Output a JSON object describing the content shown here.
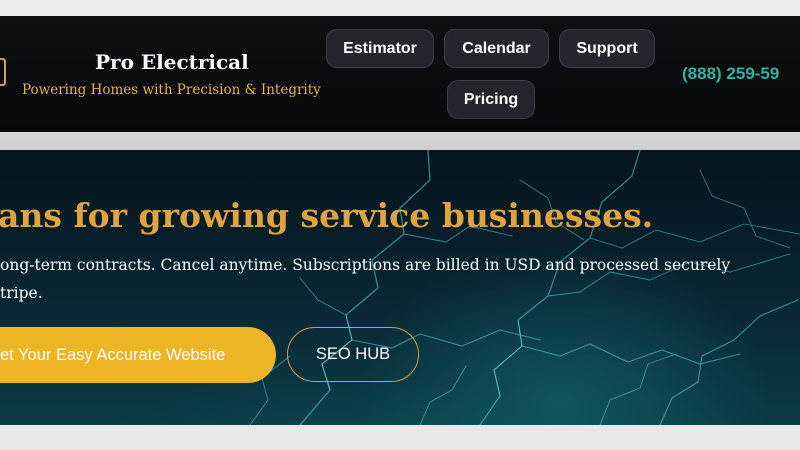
{
  "header": {
    "brand_name": "Pro Electrical",
    "tagline": "Powering Homes with Precision & Integrity",
    "nav": [
      {
        "label": "Estimator"
      },
      {
        "label": "Calendar"
      },
      {
        "label": "Support"
      },
      {
        "label": "Pricing"
      }
    ],
    "phone": "(888) 259-59"
  },
  "hero": {
    "title": "ans for growing service businesses.",
    "body_line1": "ong-term contracts. Cancel anytime. Subscriptions are billed in USD and processed securely",
    "body_line2": "tripe.",
    "cta_primary": "et Your Easy Accurate Website",
    "cta_secondary": "SEO HUB"
  },
  "colors": {
    "header_bg": "#0b0d11",
    "tagline": "#e2b63f",
    "phone": "#2fb3a3",
    "hero_title": "#e0a33e",
    "cta_primary_bg": "#edb425",
    "lightning": "#5fe0e0"
  }
}
